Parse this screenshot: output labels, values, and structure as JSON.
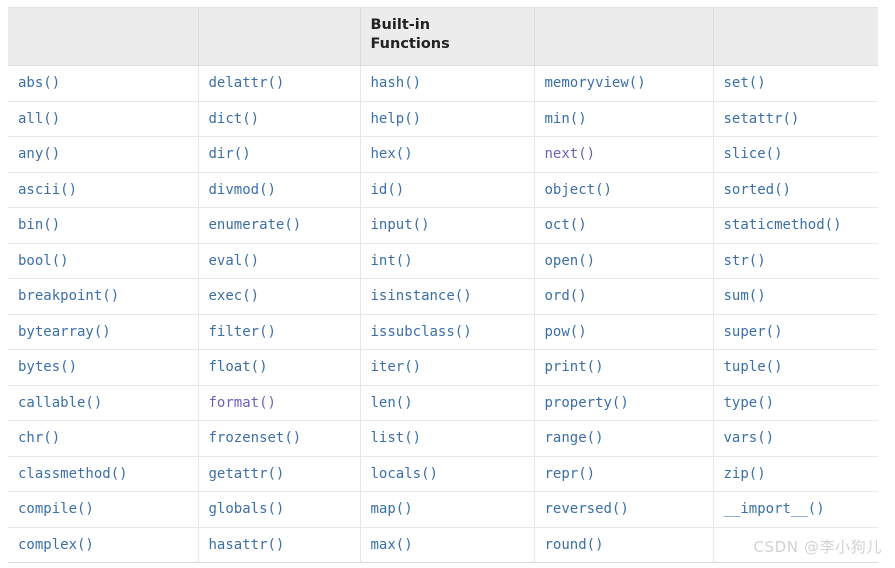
{
  "table": {
    "header": {
      "cells": [
        "",
        "",
        "Built-in\nFunctions",
        "",
        ""
      ]
    },
    "columns": 5,
    "rows": [
      [
        {
          "label": "abs()",
          "state": "link"
        },
        {
          "label": "delattr()",
          "state": "link"
        },
        {
          "label": "hash()",
          "state": "link"
        },
        {
          "label": "memoryview()",
          "state": "link"
        },
        {
          "label": "set()",
          "state": "link"
        }
      ],
      [
        {
          "label": "all()",
          "state": "link"
        },
        {
          "label": "dict()",
          "state": "link"
        },
        {
          "label": "help()",
          "state": "link"
        },
        {
          "label": "min()",
          "state": "link"
        },
        {
          "label": "setattr()",
          "state": "link"
        }
      ],
      [
        {
          "label": "any()",
          "state": "link"
        },
        {
          "label": "dir()",
          "state": "link"
        },
        {
          "label": "hex()",
          "state": "link"
        },
        {
          "label": "next()",
          "state": "visited"
        },
        {
          "label": "slice()",
          "state": "link"
        }
      ],
      [
        {
          "label": "ascii()",
          "state": "link"
        },
        {
          "label": "divmod()",
          "state": "link"
        },
        {
          "label": "id()",
          "state": "link"
        },
        {
          "label": "object()",
          "state": "link"
        },
        {
          "label": "sorted()",
          "state": "link"
        }
      ],
      [
        {
          "label": "bin()",
          "state": "link"
        },
        {
          "label": "enumerate()",
          "state": "link"
        },
        {
          "label": "input()",
          "state": "link"
        },
        {
          "label": "oct()",
          "state": "link"
        },
        {
          "label": "staticmethod()",
          "state": "link"
        }
      ],
      [
        {
          "label": "bool()",
          "state": "link"
        },
        {
          "label": "eval()",
          "state": "link"
        },
        {
          "label": "int()",
          "state": "link"
        },
        {
          "label": "open()",
          "state": "link"
        },
        {
          "label": "str()",
          "state": "link"
        }
      ],
      [
        {
          "label": "breakpoint()",
          "state": "link"
        },
        {
          "label": "exec()",
          "state": "link"
        },
        {
          "label": "isinstance()",
          "state": "link"
        },
        {
          "label": "ord()",
          "state": "link"
        },
        {
          "label": "sum()",
          "state": "link"
        }
      ],
      [
        {
          "label": "bytearray()",
          "state": "link"
        },
        {
          "label": "filter()",
          "state": "link"
        },
        {
          "label": "issubclass()",
          "state": "link"
        },
        {
          "label": "pow()",
          "state": "link"
        },
        {
          "label": "super()",
          "state": "link"
        }
      ],
      [
        {
          "label": "bytes()",
          "state": "link"
        },
        {
          "label": "float()",
          "state": "link"
        },
        {
          "label": "iter()",
          "state": "link"
        },
        {
          "label": "print()",
          "state": "link"
        },
        {
          "label": "tuple()",
          "state": "link"
        }
      ],
      [
        {
          "label": "callable()",
          "state": "link"
        },
        {
          "label": "format()",
          "state": "visited"
        },
        {
          "label": "len()",
          "state": "link"
        },
        {
          "label": "property()",
          "state": "link"
        },
        {
          "label": "type()",
          "state": "link"
        }
      ],
      [
        {
          "label": "chr()",
          "state": "link"
        },
        {
          "label": "frozenset()",
          "state": "link"
        },
        {
          "label": "list()",
          "state": "link"
        },
        {
          "label": "range()",
          "state": "link"
        },
        {
          "label": "vars()",
          "state": "link"
        }
      ],
      [
        {
          "label": "classmethod()",
          "state": "link"
        },
        {
          "label": "getattr()",
          "state": "link"
        },
        {
          "label": "locals()",
          "state": "link"
        },
        {
          "label": "repr()",
          "state": "link"
        },
        {
          "label": "zip()",
          "state": "link"
        }
      ],
      [
        {
          "label": "compile()",
          "state": "link"
        },
        {
          "label": "globals()",
          "state": "link"
        },
        {
          "label": "map()",
          "state": "link"
        },
        {
          "label": "reversed()",
          "state": "link"
        },
        {
          "label": "__import__()",
          "state": "link"
        }
      ],
      [
        {
          "label": "complex()",
          "state": "link"
        },
        {
          "label": "hasattr()",
          "state": "link"
        },
        {
          "label": "max()",
          "state": "link"
        },
        {
          "label": "round()",
          "state": "link"
        },
        {
          "label": "",
          "state": "empty"
        }
      ]
    ]
  },
  "watermark": {
    "text": "CSDN @李小狗儿"
  },
  "colors": {
    "link": "#3b6fa8",
    "visited": "#6a63b8",
    "header_bg": "#ececec",
    "header_text": "#222222",
    "border": "#e6e6e6",
    "watermark": "#d2d2d2"
  }
}
